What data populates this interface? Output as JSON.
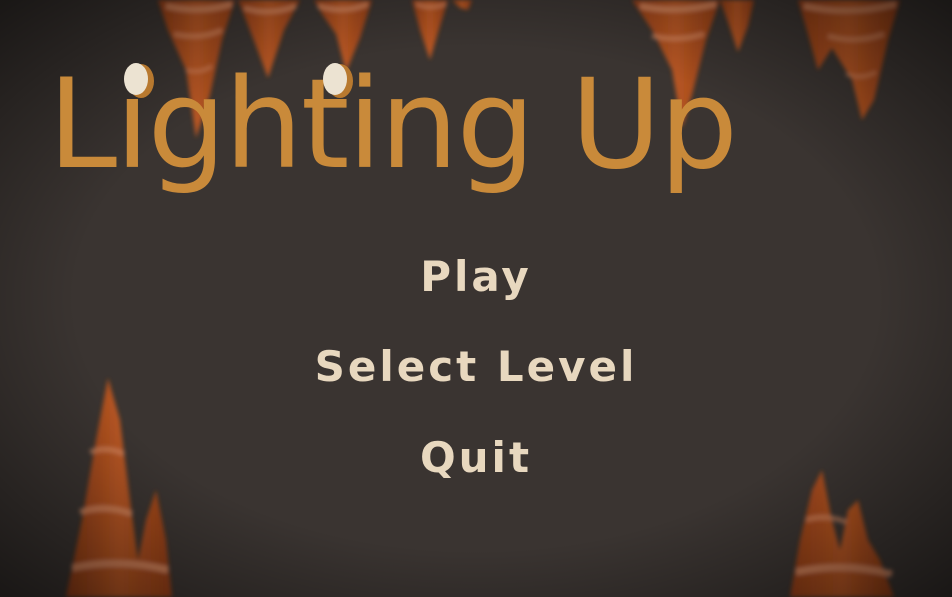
{
  "game": {
    "title": "Lighting Up"
  },
  "menu": {
    "items": [
      {
        "label": "Play"
      },
      {
        "label": "Select Level"
      },
      {
        "label": "Quit"
      }
    ]
  },
  "colors": {
    "background": "#3a3431",
    "title": "#c98a3a",
    "menu_text": "#e8d8bf",
    "stalactite": "#b8501f",
    "stalactite_stripe": "#e6946a",
    "bulb": "#ece3d2"
  }
}
